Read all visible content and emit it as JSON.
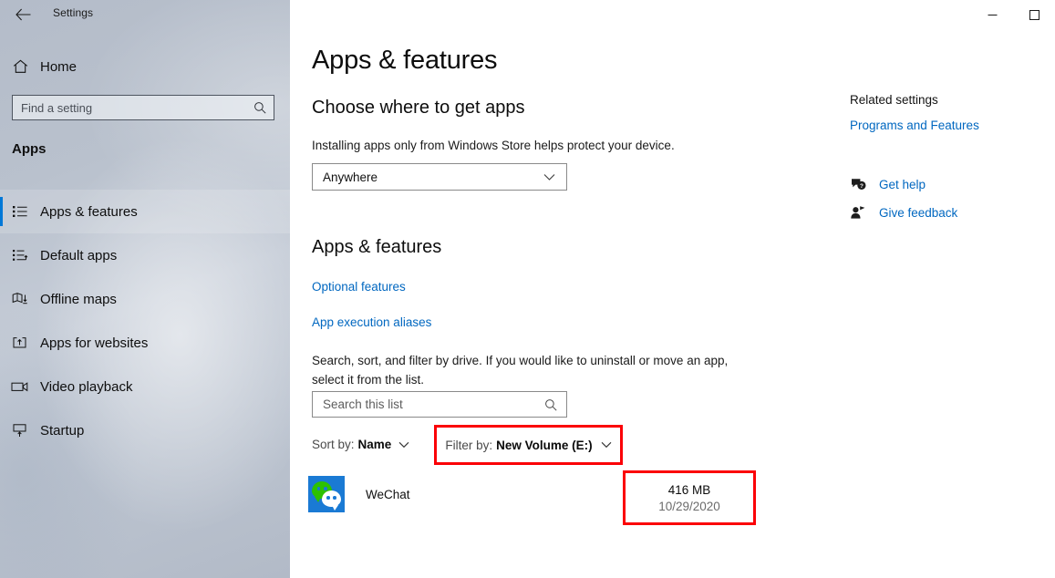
{
  "window": {
    "title": "Settings",
    "back_icon": "back-arrow-icon",
    "controls": [
      {
        "name": "minimize-button",
        "glyph": "minimize-icon"
      },
      {
        "name": "maximize-button",
        "glyph": "maximize-icon"
      }
    ]
  },
  "sidebar": {
    "home": {
      "label": "Home",
      "icon": "home-icon"
    },
    "search": {
      "placeholder": "Find a setting",
      "value": "",
      "icon": "search-icon"
    },
    "section_header": "Apps",
    "items": [
      {
        "label": "Apps & features",
        "icon": "list-bullet-icon",
        "selected": true
      },
      {
        "label": "Default apps",
        "icon": "default-apps-icon",
        "selected": false
      },
      {
        "label": "Offline maps",
        "icon": "map-download-icon",
        "selected": false
      },
      {
        "label": "Apps for websites",
        "icon": "app-website-icon",
        "selected": false
      },
      {
        "label": "Video playback",
        "icon": "video-camera-icon",
        "selected": false
      },
      {
        "label": "Startup",
        "icon": "startup-icon",
        "selected": false
      }
    ]
  },
  "main": {
    "page_title": "Apps & features",
    "section_choose": {
      "heading": "Choose where to get apps",
      "description": "Installing apps only from Windows Store helps protect your device.",
      "dropdown_value": "Anywhere",
      "dropdown_icon": "chevron-down-icon"
    },
    "section_apps": {
      "heading": "Apps & features",
      "links": [
        {
          "label": "Optional features"
        },
        {
          "label": "App execution aliases"
        }
      ],
      "description": "Search, sort, and filter by drive. If you would like to uninstall or move an app, select it from the list.",
      "search": {
        "placeholder": "Search this list",
        "value": "",
        "icon": "search-icon"
      },
      "sort": {
        "label": "Sort by:",
        "value": "Name",
        "icon": "chevron-down-icon"
      },
      "filter": {
        "label": "Filter by:",
        "value": "New Volume (E:)",
        "icon": "chevron-down-icon",
        "highlighted": true
      },
      "app_list": [
        {
          "name": "WeChat",
          "icon": "wechat-icon",
          "size": "416 MB",
          "date": "10/29/2020",
          "highlighted": true
        }
      ]
    }
  },
  "right_panel": {
    "related_heading": "Related settings",
    "related_link": "Programs and Features",
    "support": [
      {
        "label": "Get help",
        "icon": "help-question-icon"
      },
      {
        "label": "Give feedback",
        "icon": "feedback-person-icon"
      }
    ]
  },
  "colors": {
    "accent_blue": "#0078d7",
    "link_blue": "#0067c0",
    "highlight_red": "#fb0007",
    "wechat_blue": "#1a7ad4",
    "wechat_green": "#2dc100"
  }
}
